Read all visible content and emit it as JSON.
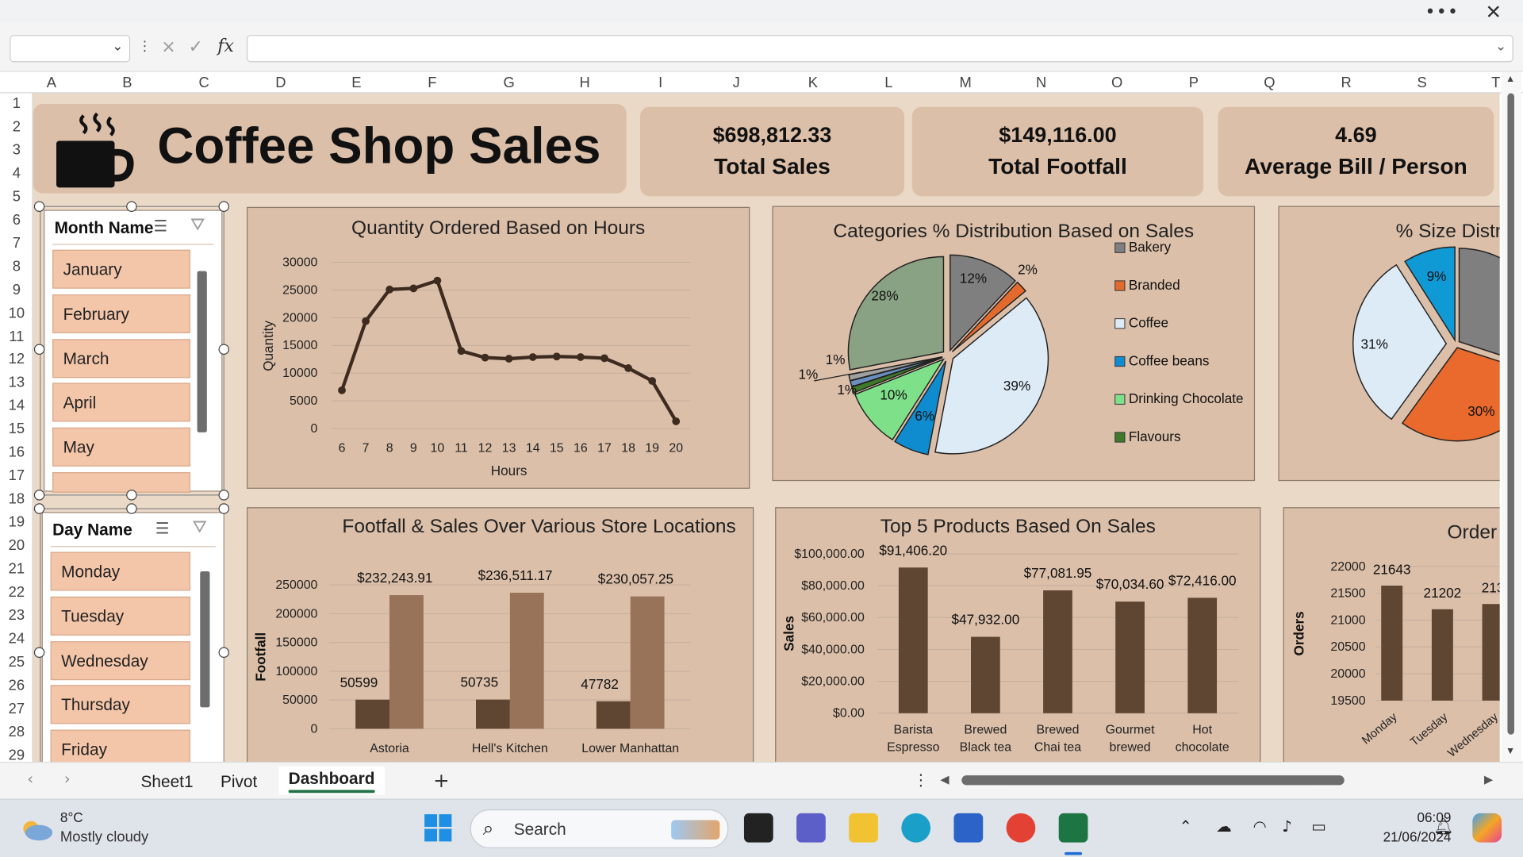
{
  "window": {
    "menu_icon": "more-icon",
    "close_icon": "close-icon"
  },
  "formula_bar": {
    "name_box_value": "",
    "formula_value": "",
    "fx_label": "fx",
    "cancel_icon": "×",
    "enter_icon": "✓"
  },
  "columns": [
    "A",
    "B",
    "C",
    "D",
    "E",
    "F",
    "G",
    "H",
    "I",
    "J",
    "K",
    "L",
    "M",
    "N",
    "O",
    "P",
    "Q",
    "R",
    "S",
    "T"
  ],
  "rows": [
    "1",
    "2",
    "3",
    "4",
    "5",
    "6",
    "7",
    "8",
    "9",
    "10",
    "11",
    "12",
    "13",
    "14",
    "15",
    "16",
    "17",
    "18",
    "19",
    "20",
    "21",
    "22",
    "23",
    "24",
    "25",
    "26",
    "27",
    "28",
    "29"
  ],
  "dashboard": {
    "title": "Coffee Shop Sales",
    "kpis": [
      {
        "value": "$698,812.33",
        "label": "Total Sales"
      },
      {
        "value": "$149,116.00",
        "label": "Total Footfall"
      },
      {
        "value": "4.69",
        "label": "Average Bill / Person"
      }
    ]
  },
  "slicers": {
    "month": {
      "header": "Month Name",
      "items": [
        "January",
        "February",
        "March",
        "April",
        "May"
      ]
    },
    "day": {
      "header": "Day Name",
      "items": [
        "Monday",
        "Tuesday",
        "Wednesday",
        "Thursday",
        "Friday"
      ]
    }
  },
  "colors": {
    "dark_bar": "#5e4632",
    "light_bar": "#98735a",
    "line": "#3d2b1f",
    "panel": "#dbbfa9",
    "sheet_bg": "#ead9c6",
    "slicer_item": "#f4c6a9"
  },
  "chart_data": [
    {
      "type": "line",
      "title": "Quantity Ordered Based on Hours",
      "xlabel": "Hours",
      "ylabel": "Quantity",
      "x": [
        6,
        7,
        8,
        9,
        10,
        11,
        12,
        13,
        14,
        15,
        16,
        17,
        18,
        19,
        20
      ],
      "values": [
        6900,
        19400,
        25100,
        25300,
        26700,
        14000,
        12800,
        12600,
        12900,
        13000,
        12900,
        12700,
        10900,
        8600,
        1300
      ],
      "ylim": [
        0,
        30000
      ],
      "yticks": [
        "0",
        "5000",
        "10000",
        "15000",
        "20000",
        "25000",
        "30000"
      ],
      "grid": true
    },
    {
      "type": "pie",
      "title": "Categories % Distribution Based on Sales",
      "legend": [
        "Bakery",
        "Branded",
        "Coffee",
        "Coffee beans",
        "Drinking Chocolate",
        "Flavours"
      ],
      "legend_position": "right",
      "slices": [
        {
          "label": "12%",
          "value": 12,
          "color": "#7f7f7f"
        },
        {
          "label": "2%",
          "value": 2,
          "color": "#e26a2c"
        },
        {
          "label": "39%",
          "value": 39,
          "color": "#ddebf7"
        },
        {
          "label": "6%",
          "value": 6,
          "color": "#0f8ccf"
        },
        {
          "label": "10%",
          "value": 10,
          "color": "#7fe08a"
        },
        {
          "label": "1%",
          "value": 1,
          "color": "#3e7a2a"
        },
        {
          "label": "1%",
          "value": 1,
          "color": "#6a8fc0"
        },
        {
          "label": "1%",
          "value": 1,
          "color": "#a0a0a0"
        },
        {
          "label": "28%",
          "value": 28,
          "color": "#8aa284"
        }
      ],
      "legend_colors": [
        "#7f7f7f",
        "#e26a2c",
        "#ddebf7",
        "#0f8ccf",
        "#7fe08a",
        "#3e7a2a"
      ]
    },
    {
      "type": "pie",
      "title": "% Size Distr",
      "slices": [
        {
          "label": "",
          "value": 30,
          "color": "#7f7f7f"
        },
        {
          "label": "30%",
          "value": 30,
          "color": "#e96a2c"
        },
        {
          "label": "31%",
          "value": 31,
          "color": "#ddebf7"
        },
        {
          "label": "9%",
          "value": 9,
          "color": "#0f9ad6"
        }
      ]
    },
    {
      "type": "bar",
      "title": "Footfall & Sales Over Various Store Locations",
      "ylabel": "Footfall",
      "categories": [
        "Astoria",
        "Hell's Kitchen",
        "Lower Manhattan"
      ],
      "series": [
        {
          "values": [
            50599,
            50735,
            47782
          ],
          "labels": [
            "50599",
            "50735",
            "47782"
          ]
        },
        {
          "values": [
            232243.91,
            236511.17,
            230057.25
          ],
          "labels": [
            "$232,243.91",
            "$236,511.17",
            "$230,057.25"
          ]
        }
      ],
      "ylim": [
        0,
        250000
      ],
      "yticks": [
        "0",
        "50000",
        "100000",
        "150000",
        "200000",
        "250000"
      ]
    },
    {
      "type": "bar",
      "title": "Top 5 Products Based On Sales",
      "ylabel": "Sales",
      "categories": [
        "Barista Espresso",
        "Brewed Black tea",
        "Brewed Chai tea",
        "Gourmet brewed",
        "Hot chocolate"
      ],
      "category_lines": [
        [
          "Barista",
          "Espresso"
        ],
        [
          "Brewed",
          "Black tea"
        ],
        [
          "Brewed",
          "Chai tea"
        ],
        [
          "Gourmet",
          "brewed"
        ],
        [
          "Hot",
          "chocolate"
        ]
      ],
      "values": [
        91406.2,
        47932.0,
        77081.95,
        70034.6,
        72416.0
      ],
      "labels": [
        "$91,406.20",
        "$47,932.00",
        "$77,081.95",
        "$70,034.60",
        "$72,416.00"
      ],
      "ylim": [
        0,
        100000
      ],
      "yticks": [
        "$0.00",
        "$20,000.00",
        "$40,000.00",
        "$60,000.00",
        "$80,000.00",
        "$100,000.00"
      ]
    },
    {
      "type": "bar",
      "title": "Order",
      "ylabel": "Orders",
      "categories": [
        "Monday",
        "Tuesday",
        "Wednesday"
      ],
      "values": [
        21643,
        21202,
        21300
      ],
      "labels": [
        "21643",
        "21202",
        "213"
      ],
      "ylim": [
        19500,
        22000
      ],
      "yticks": [
        "19500",
        "20000",
        "20500",
        "21000",
        "21500",
        "22000"
      ]
    }
  ],
  "tabs": {
    "items": [
      "Sheet1",
      "Pivot",
      "Dashboard"
    ],
    "active": "Dashboard",
    "add_label": "+",
    "prev_icon": "‹",
    "next_icon": "›"
  },
  "taskbar": {
    "weather_temp": "8°C",
    "weather_desc": "Mostly cloudy",
    "search_label": "Search",
    "time": "06:09",
    "date": "21/06/2024"
  }
}
